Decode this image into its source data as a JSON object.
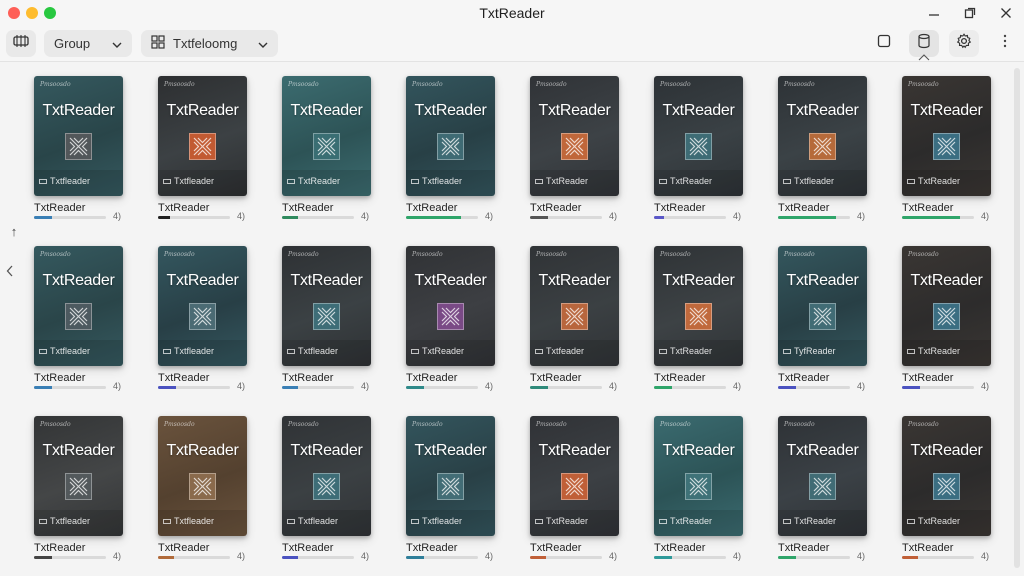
{
  "window": {
    "title": "TxtReader"
  },
  "toolbar": {
    "library_icon": "library-icon",
    "group_label": "Group",
    "view_label": "Txtfeloomg",
    "select_icon": "square-select-icon",
    "shelf_icon": "cylinder-icon",
    "settings_icon": "gear-icon",
    "more_icon": "more-vertical-icon"
  },
  "side": {
    "up_label": "↑"
  },
  "books": [
    {
      "cover_title": "TxtReader",
      "cover_small": "Pmsoosdo",
      "cover_footer": "Txtfleader",
      "name": "TxtReader",
      "progress": 0.25,
      "audio": "4)",
      "colors": [
        "#35595f",
        "#294549",
        "#52575a"
      ]
    },
    {
      "cover_title": "TxtReader",
      "cover_small": "Pmsoosdo",
      "cover_footer": "Txtfleader",
      "name": "TxtReader",
      "progress": 0.16,
      "audio": "4)",
      "colors": [
        "#2d2f31",
        "#3c4144",
        "#c25a32"
      ]
    },
    {
      "cover_title": "TxtReader",
      "cover_small": "Pmsoosdo",
      "cover_footer": "TxtReader",
      "name": "TxtReader",
      "progress": 0.22,
      "audio": "4)",
      "colors": [
        "#3c6c70",
        "#2d5356",
        "#3a6e73"
      ]
    },
    {
      "cover_title": "TxtReader",
      "cover_small": "Pmsoosdo",
      "cover_footer": "Txtfleader",
      "name": "TxtReader",
      "progress": 0.76,
      "audio": "4)",
      "colors": [
        "#33555d",
        "#284046",
        "#3f6b74"
      ]
    },
    {
      "cover_title": "TxtReader",
      "cover_small": "Pmsoosdo",
      "cover_footer": "TxtReader",
      "name": "TxtReader",
      "progress": 0.25,
      "audio": "4)",
      "colors": [
        "#303337",
        "#3d4246",
        "#c0673a"
      ]
    },
    {
      "cover_title": "TxtReader",
      "cover_small": "Pmsoosdo",
      "cover_footer": "TxtReader",
      "name": "TxtReader",
      "progress": 0.14,
      "audio": "4)",
      "colors": [
        "#2d3236",
        "#3a4145",
        "#3e6c75"
      ]
    },
    {
      "cover_title": "TxtReader",
      "cover_small": "Pmsoosdo",
      "cover_footer": "Txtfleader",
      "name": "TxtReader",
      "progress": 0.8,
      "audio": "4)",
      "colors": [
        "#2d3236",
        "#3b4246",
        "#b66a3a"
      ]
    },
    {
      "cover_title": "TxtReader",
      "cover_small": "Pmsoosdo",
      "cover_footer": "TxtReader",
      "name": "TxtReader",
      "progress": 0.8,
      "audio": "4)",
      "colors": [
        "#3a3633",
        "#2c2b2b",
        "#3b6e82"
      ]
    },
    {
      "cover_title": "TxtReader",
      "cover_small": "Pmsoosdo",
      "cover_footer": "Txtfleader",
      "name": "TxtReader",
      "progress": 0.25,
      "audio": "4)",
      "colors": [
        "#35595f",
        "#2a4549",
        "#4d5a60"
      ]
    },
    {
      "cover_title": "TxtReader",
      "cover_small": "Pmsoosdo",
      "cover_footer": "Txtfleader",
      "name": "TxtReader",
      "progress": 0.25,
      "audio": "4)",
      "colors": [
        "#34575f",
        "#283f46",
        "#4b6b74"
      ]
    },
    {
      "cover_title": "TxtReader",
      "cover_small": "Pmsoosdo",
      "cover_footer": "Txtfleader",
      "name": "TxtReader",
      "progress": 0.22,
      "audio": "4)",
      "colors": [
        "#2e3134",
        "#3b4144",
        "#3e6d77"
      ]
    },
    {
      "cover_title": "TxtReader",
      "cover_small": "Pmsoosdo",
      "cover_footer": "TxtReader",
      "name": "TxtReader",
      "progress": 0.25,
      "audio": "4)",
      "colors": [
        "#303235",
        "#3d3f43",
        "#7a4a86"
      ]
    },
    {
      "cover_title": "TxtReader",
      "cover_small": "Pmsoosdo",
      "cover_footer": "Txtfeader",
      "name": "TxtReader",
      "progress": 0.25,
      "audio": "4)",
      "colors": [
        "#303336",
        "#3b4043",
        "#b8663d"
      ]
    },
    {
      "cover_title": "TxtReader",
      "cover_small": "Pmsoosdo",
      "cover_footer": "TxtReader",
      "name": "TxtReader",
      "progress": 0.25,
      "audio": "4)",
      "colors": [
        "#2f3336",
        "#3d4245",
        "#c0693c"
      ]
    },
    {
      "cover_title": "TxtReader",
      "cover_small": "Pmsoosdo",
      "cover_footer": "TyfReader",
      "name": "TxtReader",
      "progress": 0.25,
      "audio": "4)",
      "colors": [
        "#34575e",
        "#283f45",
        "#416c75"
      ]
    },
    {
      "cover_title": "TxtReader",
      "cover_small": "Pmsoosdo",
      "cover_footer": "TxtReader",
      "name": "TxtReader",
      "progress": 0.25,
      "audio": "4)",
      "colors": [
        "#3a3633",
        "#2d2c2c",
        "#3b6e82"
      ]
    },
    {
      "cover_title": "TxtReader",
      "cover_small": "Pmsoosdo",
      "cover_footer": "Txtfleader",
      "name": "TxtReader",
      "progress": 0.25,
      "audio": "4)",
      "colors": [
        "#333536",
        "#444647",
        "#53595c"
      ]
    },
    {
      "cover_title": "TxtReader",
      "cover_small": "Pmsoosdo",
      "cover_footer": "Txtfleader",
      "name": "TxtReader",
      "progress": 0.22,
      "audio": "4)",
      "colors": [
        "#6a533d",
        "#54412f",
        "#8a6a4c"
      ]
    },
    {
      "cover_title": "TxtReader",
      "cover_small": "Pmsoosdo",
      "cover_footer": "Txtfleader",
      "name": "TxtReader",
      "progress": 0.22,
      "audio": "4)",
      "colors": [
        "#303336",
        "#3b4043",
        "#3e6d77"
      ]
    },
    {
      "cover_title": "TxtReader",
      "cover_small": "Pmsoosdo",
      "cover_footer": "Txtfleader",
      "name": "TxtReader",
      "progress": 0.25,
      "audio": "4)",
      "colors": [
        "#33555d",
        "#294046",
        "#436d76"
      ]
    },
    {
      "cover_title": "TxtReader",
      "cover_small": "Pmsoosdo",
      "cover_footer": "TxtReader",
      "name": "TxtReader",
      "progress": 0.22,
      "audio": "4)",
      "colors": [
        "#303236",
        "#3c4044",
        "#c05f37"
      ]
    },
    {
      "cover_title": "TxtReader",
      "cover_small": "Pmsoosdo",
      "cover_footer": "TxtReader",
      "name": "TxtReader",
      "progress": 0.25,
      "audio": "4)",
      "colors": [
        "#3b6b70",
        "#2c5356",
        "#3f7278"
      ]
    },
    {
      "cover_title": "TxtReader",
      "cover_small": "Pmsoosdo",
      "cover_footer": "TxtReader",
      "name": "TxtReader",
      "progress": 0.25,
      "audio": "4)",
      "colors": [
        "#2e3236",
        "#3b4146",
        "#416c75"
      ]
    },
    {
      "cover_title": "TxtReader",
      "cover_small": "Pmsoosdo",
      "cover_footer": "TxtReader",
      "name": "TxtReader",
      "progress": 0.22,
      "audio": "4)",
      "colors": [
        "#3a3633",
        "#2c2b2b",
        "#3b6e82"
      ]
    }
  ],
  "progress_colors": [
    "#3a7fb5",
    "#222222",
    "#2f8a5e",
    "#2fa56a",
    "#555555",
    "#5a57c8",
    "#2fa56a",
    "#2fa56a",
    "#3a7fb5",
    "#4b52c0",
    "#3a7fb5",
    "#2f8a8a",
    "#2f8a7a",
    "#2fa56a",
    "#4b52c0",
    "#4b52c0",
    "#444444",
    "#b06a3a",
    "#4b52c0",
    "#2f7f9a",
    "#c05f37",
    "#2f9a9a",
    "#2fa56a",
    "#c05f37"
  ]
}
